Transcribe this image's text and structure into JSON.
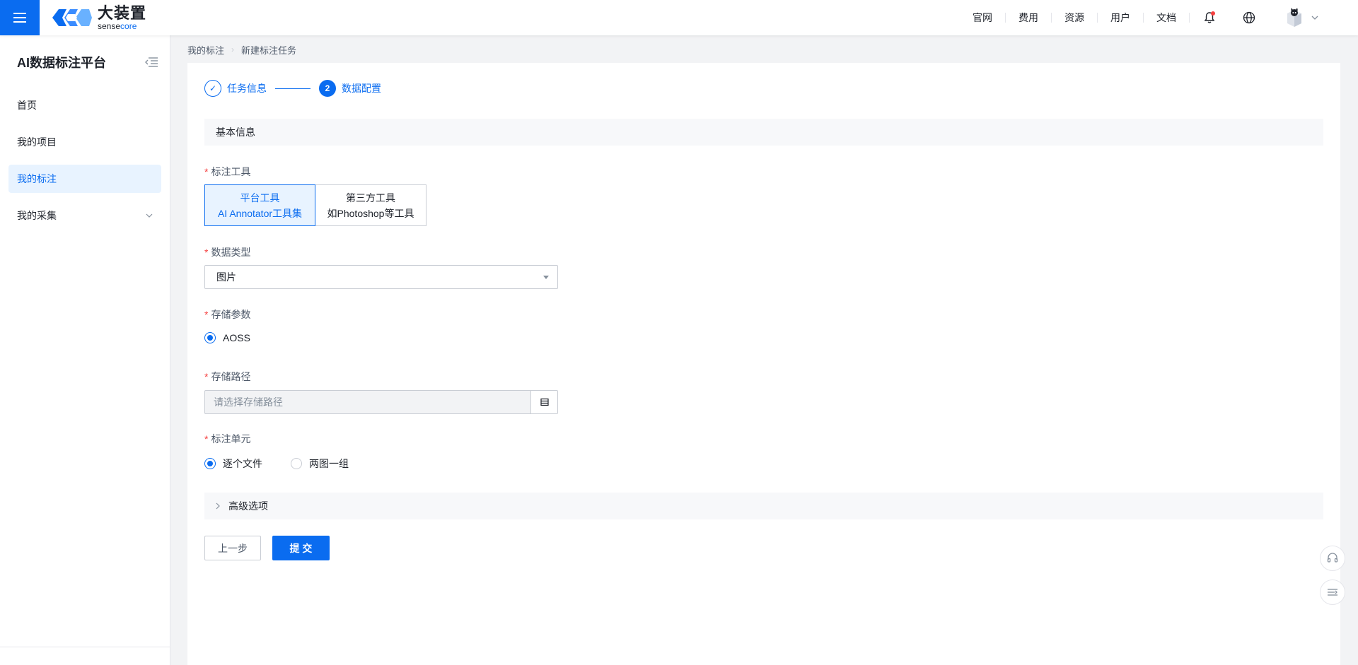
{
  "header": {
    "logo_cn": "大装置",
    "logo_en_a": "sense",
    "logo_en_b": "core",
    "nav": [
      "官网",
      "费用",
      "资源",
      "用户",
      "文档"
    ]
  },
  "sidebar": {
    "title": "AI数据标注平台",
    "items": [
      {
        "label": "首页"
      },
      {
        "label": "我的项目"
      },
      {
        "label": "我的标注",
        "active": true
      },
      {
        "label": "我的采集",
        "expandable": true
      }
    ]
  },
  "breadcrumb": [
    "我的标注",
    "新建标注任务"
  ],
  "steps": [
    {
      "number": "✓",
      "label": "任务信息",
      "status": "done"
    },
    {
      "number": "2",
      "label": "数据配置",
      "status": "current"
    }
  ],
  "form": {
    "section_title": "基本信息",
    "tool": {
      "label": "标注工具",
      "options": [
        {
          "line1": "平台工具",
          "line2": "AI Annotator工具集",
          "selected": true
        },
        {
          "line1": "第三方工具",
          "line2": "如Photoshop等工具",
          "selected": false
        }
      ]
    },
    "data_type": {
      "label": "数据类型",
      "value": "图片"
    },
    "storage_param": {
      "label": "存储参数",
      "option": "AOSS"
    },
    "storage_path": {
      "label": "存储路径",
      "placeholder": "请选择存储路径"
    },
    "unit": {
      "label": "标注单元",
      "options": [
        {
          "label": "逐个文件",
          "checked": true
        },
        {
          "label": "两图一组",
          "checked": false
        }
      ]
    },
    "advanced": "高级选项",
    "prev_button": "上一步",
    "submit_button": "提 交"
  },
  "colors": {
    "primary": "#0a6cf0",
    "required": "#f53f3f",
    "notification_dot": "#f53f3f"
  }
}
